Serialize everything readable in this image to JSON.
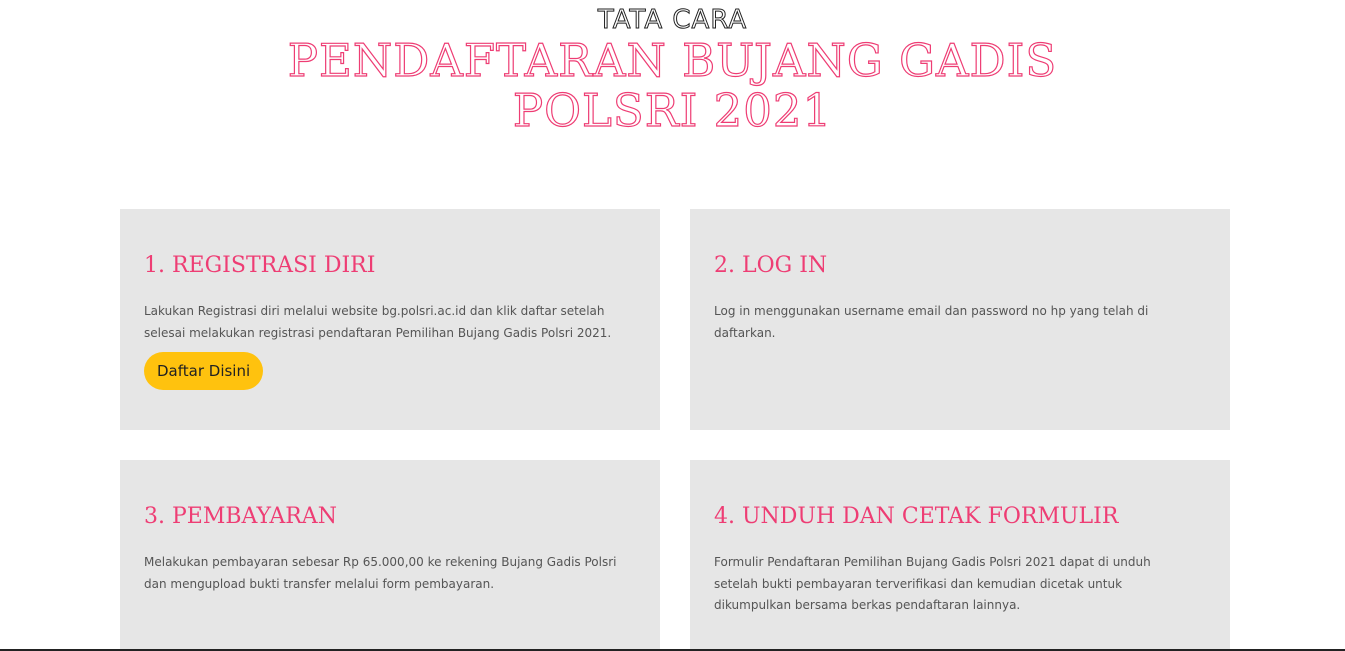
{
  "header": {
    "kicker": "TATA CARA",
    "title_line1": "PENDAFTARAN BUJANG GADIS",
    "title_line2": "POLSRI 2021"
  },
  "steps": [
    {
      "title": "1. REGISTRASI DIRI",
      "text": "Lakukan Registrasi diri melalui website bg.polsri.ac.id dan klik daftar setelah selesai melakukan registrasi pendaftaran Pemilihan Bujang Gadis Polsri 2021.",
      "button_label": "Daftar Disini"
    },
    {
      "title": "2. LOG IN",
      "text": "Log in menggunakan username email dan password no hp yang telah di daftarkan."
    },
    {
      "title": "3. PEMBAYARAN",
      "text": "Melakukan pembayaran sebesar Rp 65.000,00 ke rekening Bujang Gadis Polsri dan mengupload bukti transfer melalui form pembayaran."
    },
    {
      "title": "4. UNDUH DAN CETAK FORMULIR",
      "text": "Formulir Pendaftaran Pemilihan Bujang Gadis Polsri 2021 dapat di unduh setelah bukti pembayaran terverifikasi dan kemudian dicetak untuk dikumpulkan bersama berkas pendaftaran lainnya."
    }
  ],
  "colors": {
    "accent": "#ee3d74",
    "button": "#ffc20e",
    "card_bg": "#e6e6e6"
  }
}
